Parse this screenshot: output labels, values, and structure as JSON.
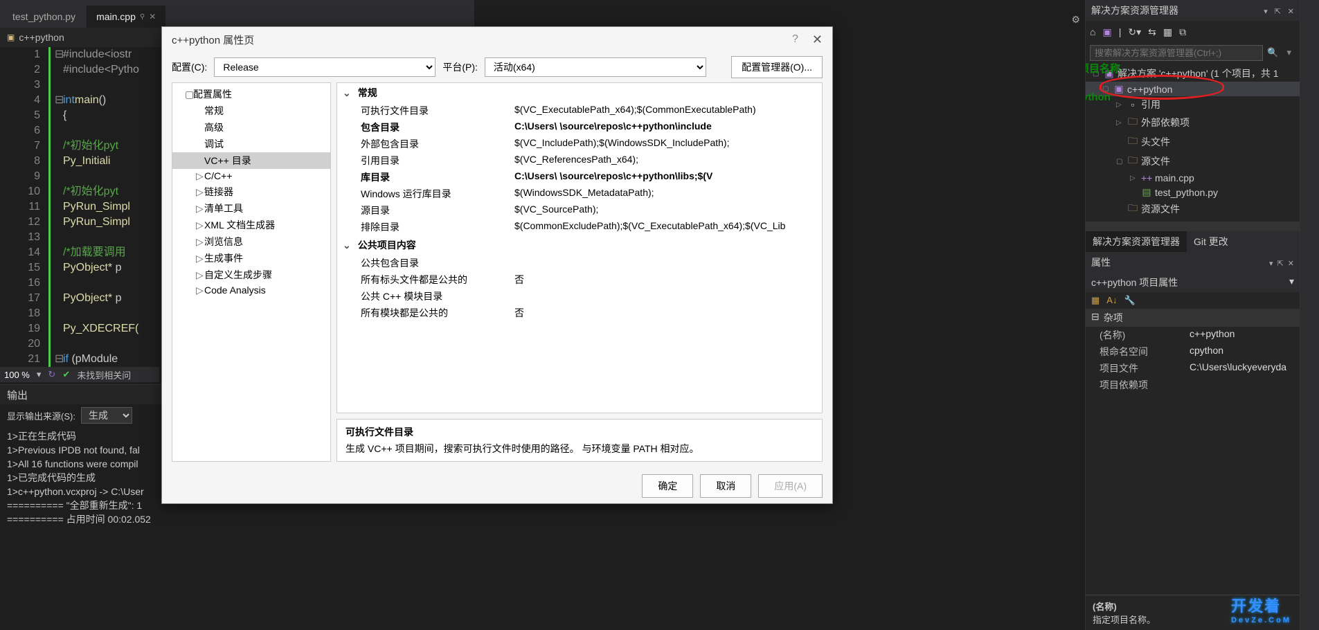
{
  "tabs": [
    {
      "label": "test_python.py",
      "active": false
    },
    {
      "label": "main.cpp",
      "active": true,
      "pinned": true
    }
  ],
  "filepath": {
    "icon": "folder-icon",
    "text": "c++python"
  },
  "editor": {
    "lines": [
      {
        "n": 1,
        "fold": "⊟",
        "html": "<span class='c-mac'>#include</span> <span class='c-mac'>&lt;iostr</span>"
      },
      {
        "n": 2,
        "fold": "",
        "html": "<span class='c-mac'>#include</span> <span class='c-mac'>&lt;Pytho</span>"
      },
      {
        "n": 3,
        "fold": "",
        "html": ""
      },
      {
        "n": 4,
        "fold": "⊟",
        "html": "<span class='c-kw'>int</span> <span class='c-fn'>main</span>()"
      },
      {
        "n": 5,
        "fold": "",
        "html": "{"
      },
      {
        "n": 6,
        "fold": "",
        "html": ""
      },
      {
        "n": 7,
        "fold": "",
        "html": "    <span class='c-com'>/*初始化pyt</span>"
      },
      {
        "n": 8,
        "fold": "",
        "html": "    <span class='c-id'>Py_Initiali</span>"
      },
      {
        "n": 9,
        "fold": "",
        "html": ""
      },
      {
        "n": 10,
        "fold": "",
        "html": "    <span class='c-com'>/*初始化pyt</span>"
      },
      {
        "n": 11,
        "fold": "",
        "html": "    <span class='c-id'>PyRun_Simpl</span>"
      },
      {
        "n": 12,
        "fold": "",
        "html": "    <span class='c-id'>PyRun_Simpl</span>"
      },
      {
        "n": 13,
        "fold": "",
        "html": ""
      },
      {
        "n": 14,
        "fold": "",
        "html": "    <span class='c-com'>/*加载要调用</span>"
      },
      {
        "n": 15,
        "fold": "",
        "html": "    <span class='c-id'>PyObject*</span> p"
      },
      {
        "n": 16,
        "fold": "",
        "html": ""
      },
      {
        "n": 17,
        "fold": "",
        "html": "    <span class='c-id'>PyObject*</span> p"
      },
      {
        "n": 18,
        "fold": "",
        "html": ""
      },
      {
        "n": 19,
        "fold": "",
        "html": "    <span class='c-id'>Py_XDECREF(</span>"
      },
      {
        "n": 20,
        "fold": "",
        "html": ""
      },
      {
        "n": 21,
        "fold": "⊟",
        "html": "    <span class='c-kw'>if</span> (pModule"
      }
    ]
  },
  "editorStatus": {
    "zoom": "100 %",
    "issues": "未找到相关问"
  },
  "output": {
    "title": "输出",
    "sourceLabel": "显示输出来源(S):",
    "sourceValue": "生成",
    "lines": [
      "1>正在生成代码",
      "1>Previous IPDB not found, fal",
      "1>All 16 functions were compil",
      "1>已完成代码的生成",
      "1>c++python.vcxproj -> C:\\User",
      "========== \"全部重新生成\": 1",
      "========== 占用时间 00:02.052"
    ]
  },
  "dialog": {
    "title": "c++python 属性页",
    "configLabel": "配置(C):",
    "configValue": "Release",
    "platformLabel": "平台(P):",
    "platformValue": "活动(x64)",
    "configMgrBtn": "配置管理器(O)...",
    "tree": [
      {
        "label": "配置属性",
        "exp": "▢",
        "lvl": 0
      },
      {
        "label": "常规",
        "lvl": 1
      },
      {
        "label": "高级",
        "lvl": 1
      },
      {
        "label": "调试",
        "lvl": 1
      },
      {
        "label": "VC++ 目录",
        "lvl": 1,
        "sel": true
      },
      {
        "label": "C/C++",
        "exp": "▷",
        "lvl": 1
      },
      {
        "label": "链接器",
        "exp": "▷",
        "lvl": 1
      },
      {
        "label": "清单工具",
        "exp": "▷",
        "lvl": 1
      },
      {
        "label": "XML 文档生成器",
        "exp": "▷",
        "lvl": 1
      },
      {
        "label": "浏览信息",
        "exp": "▷",
        "lvl": 1
      },
      {
        "label": "生成事件",
        "exp": "▷",
        "lvl": 1
      },
      {
        "label": "自定义生成步骤",
        "exp": "▷",
        "lvl": 1
      },
      {
        "label": "Code Analysis",
        "exp": "▷",
        "lvl": 1
      }
    ],
    "grid": {
      "cat1": "常规",
      "props1": [
        {
          "k": "可执行文件目录",
          "v": "$(VC_ExecutablePath_x64);$(CommonExecutablePath)"
        },
        {
          "k": "包含目录",
          "v": "C:\\Users\\              \\source\\repos\\c++python\\include",
          "bold": true
        },
        {
          "k": "外部包含目录",
          "v": "$(VC_IncludePath);$(WindowsSDK_IncludePath);"
        },
        {
          "k": "引用目录",
          "v": "$(VC_ReferencesPath_x64);"
        },
        {
          "k": "库目录",
          "v": "C:\\Users\\                      \\source\\repos\\c++python\\libs;$(V",
          "bold": true
        },
        {
          "k": "Windows 运行库目录",
          "v": "$(WindowsSDK_MetadataPath);"
        },
        {
          "k": "源目录",
          "v": "$(VC_SourcePath);"
        },
        {
          "k": "排除目录",
          "v": "$(CommonExcludePath);$(VC_ExecutablePath_x64);$(VC_Lib"
        }
      ],
      "cat2": "公共项目内容",
      "props2": [
        {
          "k": "公共包含目录",
          "v": ""
        },
        {
          "k": "所有标头文件都是公共的",
          "v": "否"
        },
        {
          "k": "公共 C++ 模块目录",
          "v": ""
        },
        {
          "k": "所有模块都是公共的",
          "v": "否"
        }
      ]
    },
    "desc": {
      "title": "可执行文件目录",
      "body": "生成 VC++ 项目期间，搜索可执行文件时使用的路径。 与环境变量 PATH 相对应。"
    },
    "buttons": {
      "ok": "确定",
      "cancel": "取消",
      "apply": "应用(A)"
    }
  },
  "solutionExplorer": {
    "title": "解决方案资源管理器",
    "searchPlaceholder": "搜索解决方案资源管理器(Ctrl+;)",
    "solutionLine": "解决方案 'c++python' (1 个项目，共 1",
    "annotations": {
      "rightClick": "右击项目名称",
      "projLabel": "c++python"
    },
    "nodes": [
      {
        "label": "c++python",
        "icon": "proj",
        "lvl": 1,
        "exp": "▢",
        "sel": true
      },
      {
        "label": "引用",
        "icon": "ref",
        "lvl": 2,
        "exp": "▷"
      },
      {
        "label": "外部依赖项",
        "icon": "folder",
        "lvl": 2,
        "exp": "▷"
      },
      {
        "label": "头文件",
        "icon": "folder",
        "lvl": 2
      },
      {
        "label": "源文件",
        "icon": "folder",
        "lvl": 2,
        "exp": "▢"
      },
      {
        "label": "main.cpp",
        "icon": "cpp",
        "lvl": 3,
        "exp": "▷"
      },
      {
        "label": "test_python.py",
        "icon": "py",
        "lvl": 3
      },
      {
        "label": "资源文件",
        "icon": "folder",
        "lvl": 2
      }
    ],
    "tabs": [
      {
        "label": "解决方案资源管理器",
        "active": true
      },
      {
        "label": "Git 更改",
        "active": false
      }
    ]
  },
  "properties": {
    "title": "属性",
    "subtitle": "c++python 项目属性",
    "cat": "杂项",
    "rows": [
      {
        "k": "(名称)",
        "v": "c++python"
      },
      {
        "k": "根命名空间",
        "v": "cpython"
      },
      {
        "k": "项目文件",
        "v": "C:\\Users\\luckyeveryda"
      },
      {
        "k": "项目依赖项",
        "v": ""
      }
    ],
    "descTitle": "(名称)",
    "descBody": "指定项目名称。"
  },
  "watermark": {
    "main": "开发着",
    "sub": "DevZe.CoM"
  }
}
